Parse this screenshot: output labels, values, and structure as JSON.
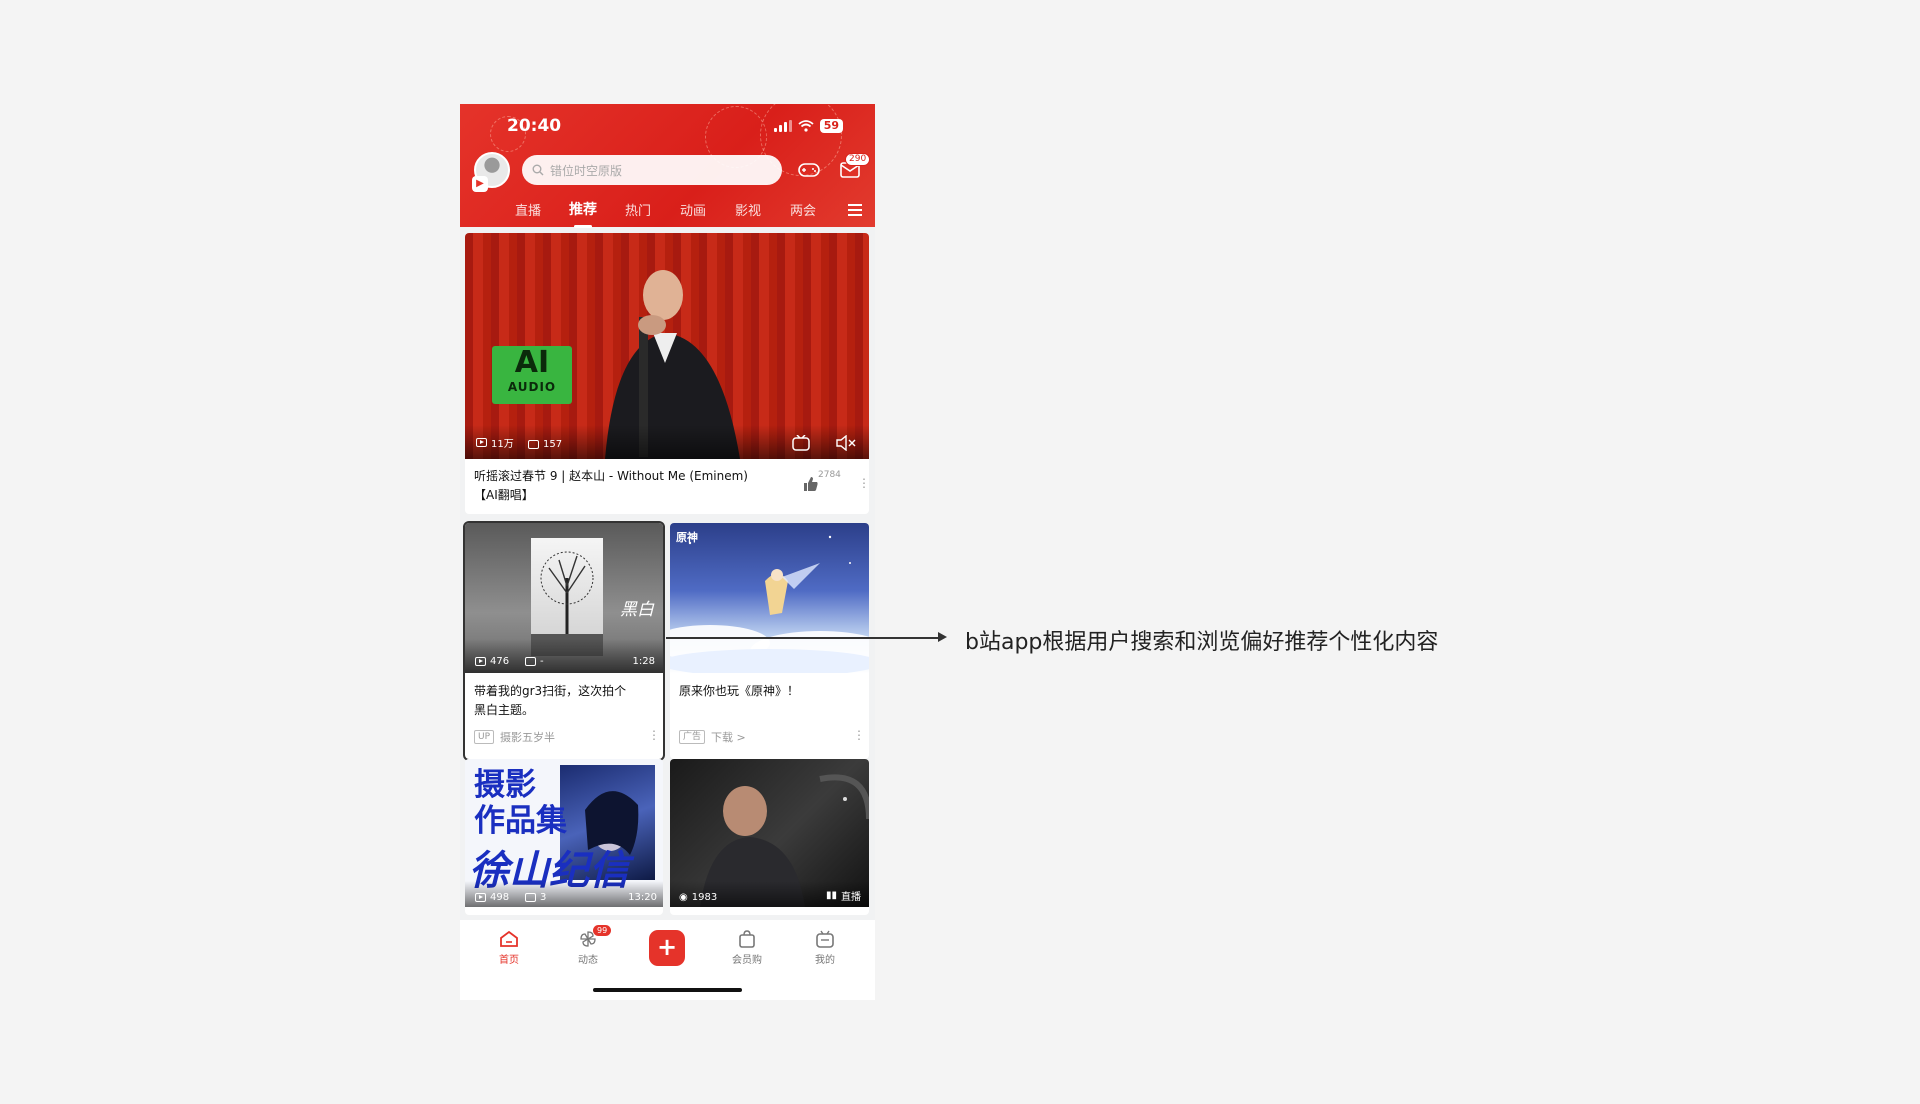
{
  "status_bar": {
    "time": "20:40",
    "battery": "59"
  },
  "header": {
    "search_placeholder": "错位时空原版",
    "mail_badge": "290",
    "tabs": [
      {
        "label": "直播",
        "active": false
      },
      {
        "label": "推荐",
        "active": true
      },
      {
        "label": "热门",
        "active": false
      },
      {
        "label": "动画",
        "active": false
      },
      {
        "label": "影视",
        "active": false
      },
      {
        "label": "两会",
        "active": false
      }
    ]
  },
  "feed": {
    "featured": {
      "views": "11万",
      "danmaku": "157",
      "badge_text": "AI",
      "badge_sub": "AUDIO",
      "title_line1": "听摇滚过春节 9 | 赵本山 - Without Me (Eminem)",
      "title_line2": "【AI翻唱】",
      "likes": "2784"
    },
    "card_left": {
      "views": "476",
      "danmaku": "-",
      "duration": "1:28",
      "overlay_text": "黑白",
      "title_line1": "带着我的gr3扫街，这次拍个",
      "title_line2": "黑白主题。",
      "author": "摄影五岁半"
    },
    "card_right": {
      "logo_text": "原神",
      "title": "原来你也玩《原神》！",
      "ad_tag": "广告",
      "download": "下载 >"
    },
    "card_bottom_left": {
      "line1": "摄影",
      "line2": "作品集",
      "line3": "徐山纪信",
      "views": "498",
      "danmaku": "3",
      "duration": "13:20"
    },
    "card_bottom_right": {
      "views": "1983",
      "live_tag": "直播"
    }
  },
  "bottom_nav": {
    "items": [
      {
        "label": "首页",
        "active": true
      },
      {
        "label": "动态",
        "active": false,
        "badge": "99"
      },
      {
        "label": "会员购",
        "active": false
      },
      {
        "label": "我的",
        "active": false
      }
    ],
    "plus": "+"
  },
  "annotation": "b站app根据用户搜索和浏览偏好推荐个性化内容",
  "colors": {
    "brand_red": "#e5332a",
    "background": "#f4f4f4"
  }
}
